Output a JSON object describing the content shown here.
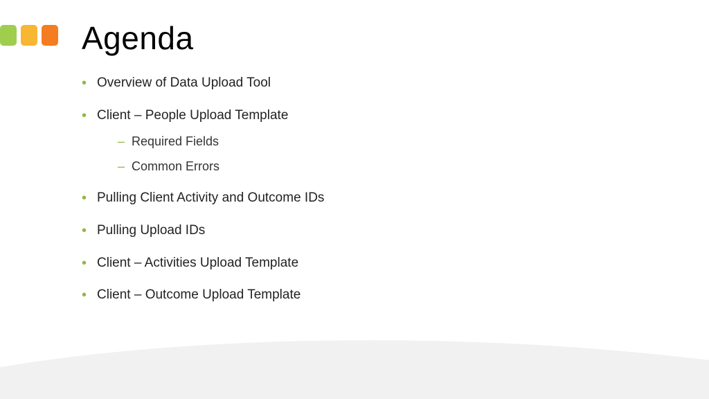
{
  "accent_colors": [
    "#9fce4e",
    "#f7b733",
    "#f57c1f"
  ],
  "title": "Agenda",
  "bullets": [
    {
      "text": "Overview of Data Upload Tool"
    },
    {
      "text": "Client – People Upload Template",
      "sub": [
        "Required Fields",
        "Common Errors"
      ]
    },
    {
      "text": "Pulling Client Activity and Outcome IDs"
    },
    {
      "text": "Pulling Upload IDs"
    },
    {
      "text": "Client – Activities Upload Template"
    },
    {
      "text": "Client – Outcome Upload Template"
    }
  ]
}
